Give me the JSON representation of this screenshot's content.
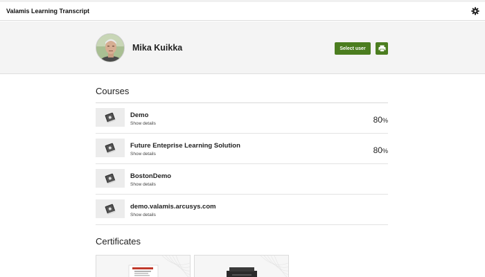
{
  "header": {
    "title": "Valamis Learning Transcript",
    "settings_icon": "gear-icon"
  },
  "profile": {
    "name": "Mika Kuikka",
    "select_user_label": "Select user",
    "print_icon": "printer-icon"
  },
  "courses": {
    "title": "Courses",
    "items": [
      {
        "name": "Demo",
        "details_label": "Show details",
        "progress": "80",
        "unit": "%"
      },
      {
        "name": "Future Enteprise Learning Solution",
        "details_label": "Show details",
        "progress": "80",
        "unit": "%"
      },
      {
        "name": "BostonDemo",
        "details_label": "Show details",
        "progress": "",
        "unit": ""
      },
      {
        "name": "demo.valamis.arcusys.com",
        "details_label": "Show details",
        "progress": "",
        "unit": ""
      }
    ]
  },
  "certificates": {
    "title": "Certificates",
    "items": [
      {
        "image": "certificate-document-image"
      },
      {
        "image": "printer-device-image"
      }
    ]
  },
  "colors": {
    "accent": "#4b7d1f",
    "profile_bg": "#f4f4f4",
    "thumb_bg": "#ececec"
  }
}
